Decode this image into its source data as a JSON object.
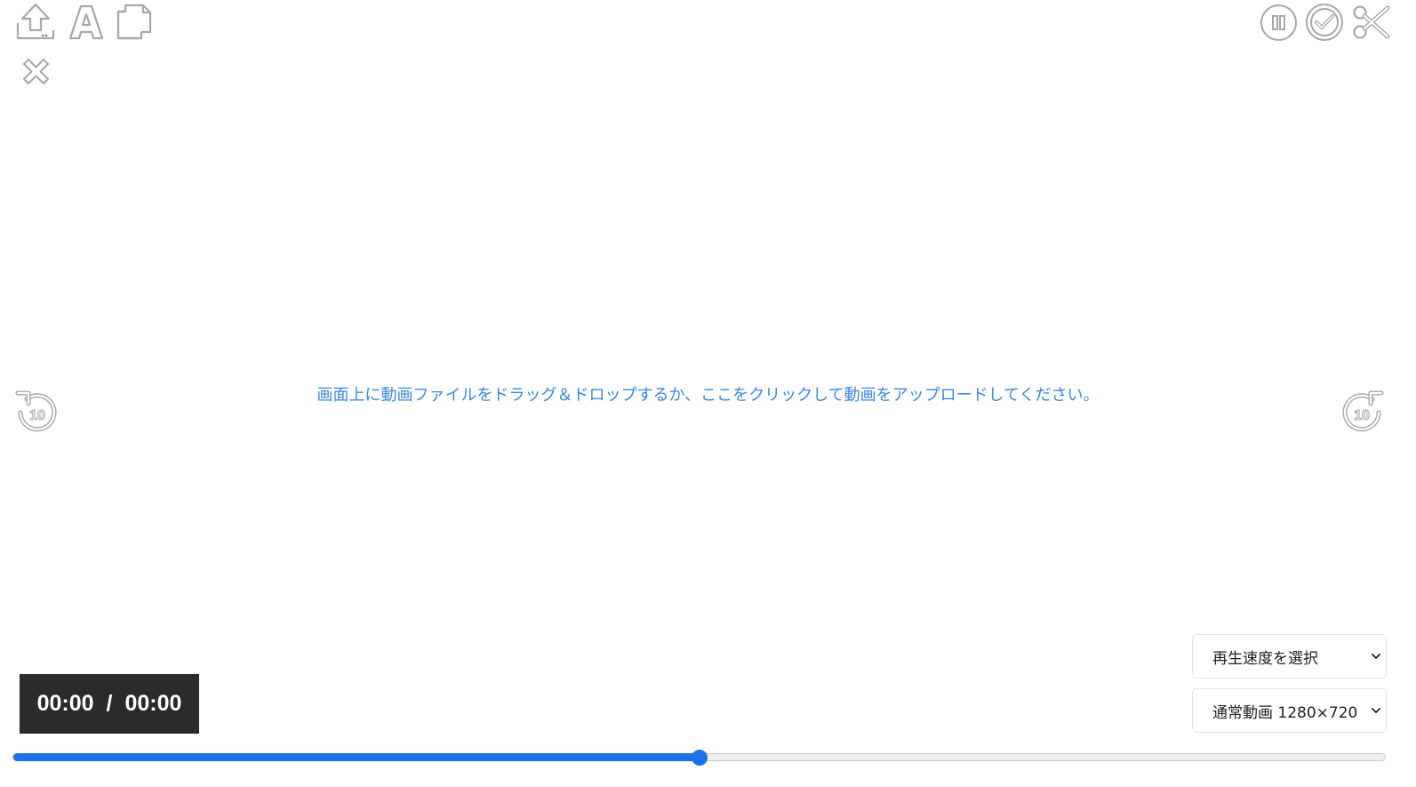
{
  "toolbar": {
    "icons": [
      "upload-icon",
      "text-icon",
      "copy-icon",
      "close-icon"
    ],
    "right_icons": [
      "pause-icon",
      "check-icon",
      "scissors-icon"
    ]
  },
  "player": {
    "upload_hint": "画面上に動画ファイルをドラッグ＆ドロップするか、ここをクリックして動画をアップロードしてください。",
    "rewind_label": "10",
    "forward_label": "10",
    "current_time": "00:00",
    "separator": "/",
    "total_time": "00:00",
    "progress": 0.5
  },
  "controls": {
    "speed_select": "再生速度を選択",
    "resolution_select": "通常動画 1280×720"
  },
  "colors": {
    "accent": "#1a74e8",
    "hint_text": "#3a87e5",
    "icon_stroke": "#a8a8a8",
    "time_bg": "#2b2b2b"
  }
}
